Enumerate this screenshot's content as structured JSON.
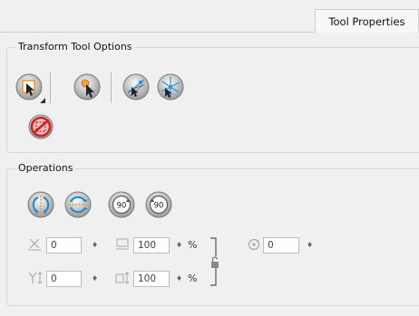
{
  "tab": {
    "label": "Tool Properties"
  },
  "transform_group": {
    "title": "Transform Tool Options",
    "tools": [
      {
        "name": "transform-tool-icon"
      },
      {
        "name": "select-by-color-tool-icon"
      },
      {
        "name": "snap-tool-icon"
      },
      {
        "name": "snap-grid-tool-icon"
      },
      {
        "name": "disable-tool-icon"
      }
    ]
  },
  "operations_group": {
    "title": "Operations",
    "ops": [
      {
        "name": "flip-horizontal-icon"
      },
      {
        "name": "flip-vertical-icon"
      },
      {
        "name": "rotate-90-cw-icon",
        "label": "90"
      },
      {
        "name": "rotate-90-ccw-icon",
        "label": "90"
      }
    ],
    "fields": {
      "x": {
        "value": "0"
      },
      "y": {
        "value": "0"
      },
      "width": {
        "value": "100",
        "unit": "%"
      },
      "height": {
        "value": "100",
        "unit": "%"
      },
      "angle": {
        "value": "0"
      }
    }
  }
}
